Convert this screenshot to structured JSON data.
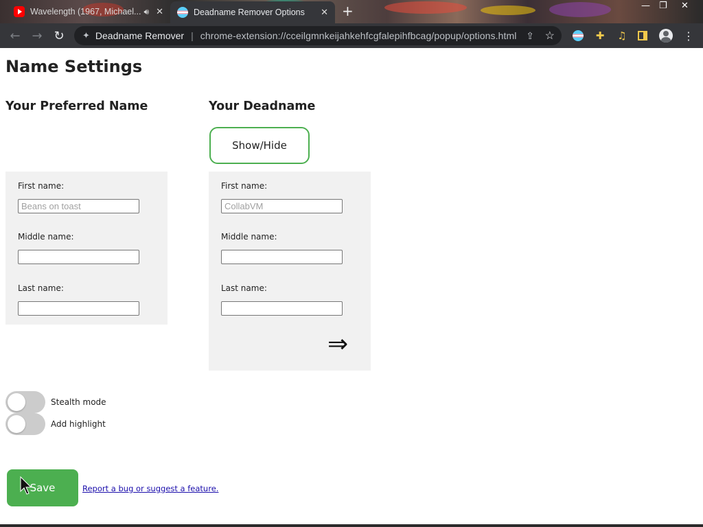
{
  "browser": {
    "tabs": [
      {
        "label": "Wavelength (1967, Michael...",
        "favicon": "youtube-icon",
        "audible": true,
        "active": false
      },
      {
        "label": "Deadname Remover Options",
        "favicon": "trans-flag-icon",
        "active": true
      }
    ],
    "omnibox": {
      "site_name": "Deadname Remover",
      "url": "chrome-extension://cceilgmnkeijahkehfcgfalepihfbcag/popup/options.html"
    }
  },
  "page": {
    "title": "Name Settings",
    "preferred": {
      "heading": "Your Preferred Name",
      "first_label": "First name:",
      "first_placeholder": "Beans on toast",
      "middle_label": "Middle name:",
      "middle_value": "",
      "last_label": "Last name:",
      "last_value": ""
    },
    "deadname": {
      "heading": "Your Deadname",
      "show_hide_label": "Show/Hide",
      "first_label": "First name:",
      "first_placeholder": "CollabVM",
      "middle_label": "Middle name:",
      "middle_value": "",
      "last_label": "Last name:",
      "last_value": "",
      "arrow": "⇒"
    },
    "toggles": [
      {
        "label": "Stealth mode",
        "on": false
      },
      {
        "label": "Add highlight",
        "on": false
      }
    ],
    "save_label": "Save",
    "report_link": "Report a bug or suggest a feature."
  },
  "colors": {
    "accent": "#4caf50",
    "panel_bg": "#f1f1f1",
    "toggle_off": "#cccccc",
    "link": "#1a0dab",
    "chrome_dark": "#35363a"
  }
}
